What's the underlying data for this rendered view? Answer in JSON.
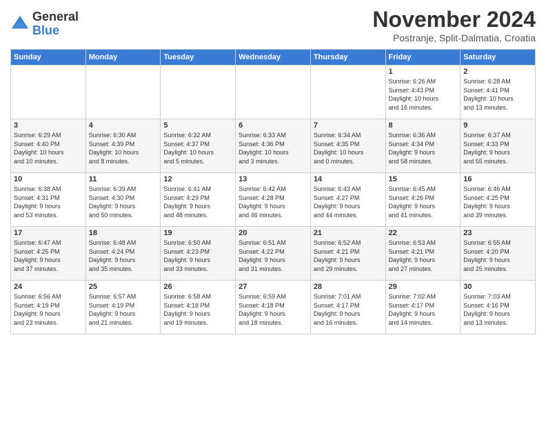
{
  "header": {
    "logo_general": "General",
    "logo_blue": "Blue",
    "month_title": "November 2024",
    "subtitle": "Postranje, Split-Dalmatia, Croatia"
  },
  "calendar": {
    "headers": [
      "Sunday",
      "Monday",
      "Tuesday",
      "Wednesday",
      "Thursday",
      "Friday",
      "Saturday"
    ],
    "weeks": [
      [
        {
          "day": "",
          "info": ""
        },
        {
          "day": "",
          "info": ""
        },
        {
          "day": "",
          "info": ""
        },
        {
          "day": "",
          "info": ""
        },
        {
          "day": "",
          "info": ""
        },
        {
          "day": "1",
          "info": "Sunrise: 6:26 AM\nSunset: 4:43 PM\nDaylight: 10 hours\nand 16 minutes."
        },
        {
          "day": "2",
          "info": "Sunrise: 6:28 AM\nSunset: 4:41 PM\nDaylight: 10 hours\nand 13 minutes."
        }
      ],
      [
        {
          "day": "3",
          "info": "Sunrise: 6:29 AM\nSunset: 4:40 PM\nDaylight: 10 hours\nand 10 minutes."
        },
        {
          "day": "4",
          "info": "Sunrise: 6:30 AM\nSunset: 4:39 PM\nDaylight: 10 hours\nand 8 minutes."
        },
        {
          "day": "5",
          "info": "Sunrise: 6:32 AM\nSunset: 4:37 PM\nDaylight: 10 hours\nand 5 minutes."
        },
        {
          "day": "6",
          "info": "Sunrise: 6:33 AM\nSunset: 4:36 PM\nDaylight: 10 hours\nand 3 minutes."
        },
        {
          "day": "7",
          "info": "Sunrise: 6:34 AM\nSunset: 4:35 PM\nDaylight: 10 hours\nand 0 minutes."
        },
        {
          "day": "8",
          "info": "Sunrise: 6:36 AM\nSunset: 4:34 PM\nDaylight: 9 hours\nand 58 minutes."
        },
        {
          "day": "9",
          "info": "Sunrise: 6:37 AM\nSunset: 4:33 PM\nDaylight: 9 hours\nand 55 minutes."
        }
      ],
      [
        {
          "day": "10",
          "info": "Sunrise: 6:38 AM\nSunset: 4:31 PM\nDaylight: 9 hours\nand 53 minutes."
        },
        {
          "day": "11",
          "info": "Sunrise: 6:39 AM\nSunset: 4:30 PM\nDaylight: 9 hours\nand 50 minutes."
        },
        {
          "day": "12",
          "info": "Sunrise: 6:41 AM\nSunset: 4:29 PM\nDaylight: 9 hours\nand 48 minutes."
        },
        {
          "day": "13",
          "info": "Sunrise: 6:42 AM\nSunset: 4:28 PM\nDaylight: 9 hours\nand 46 minutes."
        },
        {
          "day": "14",
          "info": "Sunrise: 6:43 AM\nSunset: 4:27 PM\nDaylight: 9 hours\nand 44 minutes."
        },
        {
          "day": "15",
          "info": "Sunrise: 6:45 AM\nSunset: 4:26 PM\nDaylight: 9 hours\nand 41 minutes."
        },
        {
          "day": "16",
          "info": "Sunrise: 6:46 AM\nSunset: 4:25 PM\nDaylight: 9 hours\nand 39 minutes."
        }
      ],
      [
        {
          "day": "17",
          "info": "Sunrise: 6:47 AM\nSunset: 4:25 PM\nDaylight: 9 hours\nand 37 minutes."
        },
        {
          "day": "18",
          "info": "Sunrise: 6:48 AM\nSunset: 4:24 PM\nDaylight: 9 hours\nand 35 minutes."
        },
        {
          "day": "19",
          "info": "Sunrise: 6:50 AM\nSunset: 4:23 PM\nDaylight: 9 hours\nand 33 minutes."
        },
        {
          "day": "20",
          "info": "Sunrise: 6:51 AM\nSunset: 4:22 PM\nDaylight: 9 hours\nand 31 minutes."
        },
        {
          "day": "21",
          "info": "Sunrise: 6:52 AM\nSunset: 4:21 PM\nDaylight: 9 hours\nand 29 minutes."
        },
        {
          "day": "22",
          "info": "Sunrise: 6:53 AM\nSunset: 4:21 PM\nDaylight: 9 hours\nand 27 minutes."
        },
        {
          "day": "23",
          "info": "Sunrise: 6:55 AM\nSunset: 4:20 PM\nDaylight: 9 hours\nand 25 minutes."
        }
      ],
      [
        {
          "day": "24",
          "info": "Sunrise: 6:56 AM\nSunset: 4:19 PM\nDaylight: 9 hours\nand 23 minutes."
        },
        {
          "day": "25",
          "info": "Sunrise: 6:57 AM\nSunset: 4:19 PM\nDaylight: 9 hours\nand 21 minutes."
        },
        {
          "day": "26",
          "info": "Sunrise: 6:58 AM\nSunset: 4:18 PM\nDaylight: 9 hours\nand 19 minutes."
        },
        {
          "day": "27",
          "info": "Sunrise: 6:59 AM\nSunset: 4:18 PM\nDaylight: 9 hours\nand 18 minutes."
        },
        {
          "day": "28",
          "info": "Sunrise: 7:01 AM\nSunset: 4:17 PM\nDaylight: 9 hours\nand 16 minutes."
        },
        {
          "day": "29",
          "info": "Sunrise: 7:02 AM\nSunset: 4:17 PM\nDaylight: 9 hours\nand 14 minutes."
        },
        {
          "day": "30",
          "info": "Sunrise: 7:03 AM\nSunset: 4:16 PM\nDaylight: 9 hours\nand 13 minutes."
        }
      ]
    ]
  }
}
